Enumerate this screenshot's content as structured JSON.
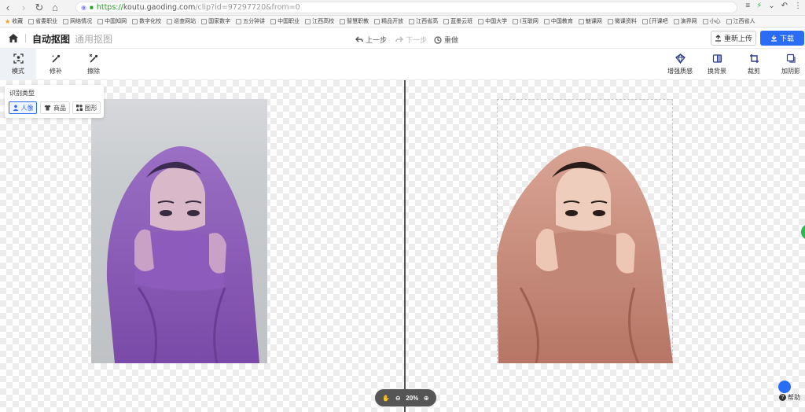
{
  "browser": {
    "url_scheme": "https://",
    "url_host": "koutu.gaoding.com",
    "url_path": "/clip?id=97297720&from=0",
    "bookmarks": [
      "收藏",
      "省委职业",
      "网络情况",
      "中国知网",
      "数字化校",
      "巡查网站",
      "国家数字",
      "五分钟讲",
      "中国职业",
      "江西高校",
      "智慧职教",
      "精品开放",
      "江西省高",
      "蓝墨云班",
      "中国大学",
      "(互联网",
      "中国教育",
      "魅课网",
      "微课资料",
      "[开课吧",
      "演界网",
      "小心",
      "江西省人"
    ]
  },
  "header": {
    "tab_active": "自动抠图",
    "tab_inactive": "通用抠图",
    "undo_label": "上一步",
    "redo_label": "下一步",
    "reset_label": "重做",
    "reupload_label": "重新上传",
    "download_label": "下载"
  },
  "tools_left": [
    {
      "label": "模式",
      "icon": "mode-icon"
    },
    {
      "label": "修补",
      "icon": "repair-icon"
    },
    {
      "label": "擦除",
      "icon": "erase-icon"
    }
  ],
  "tools_right": [
    {
      "label": "增强质感",
      "icon": "enhance-icon"
    },
    {
      "label": "换背景",
      "icon": "background-icon"
    },
    {
      "label": "裁剪",
      "icon": "crop-icon"
    },
    {
      "label": "加阴影",
      "icon": "shadow-icon"
    }
  ],
  "type_panel": {
    "title": "识别类型",
    "options": [
      "人像",
      "商品",
      "图形"
    ],
    "selected": "人像"
  },
  "zoom": {
    "value": "20%"
  },
  "help": {
    "label": "帮助"
  },
  "colors": {
    "accent": "#2a6df4",
    "left_tint": "#8a4fb8",
    "right_tint": "#c98a78"
  }
}
